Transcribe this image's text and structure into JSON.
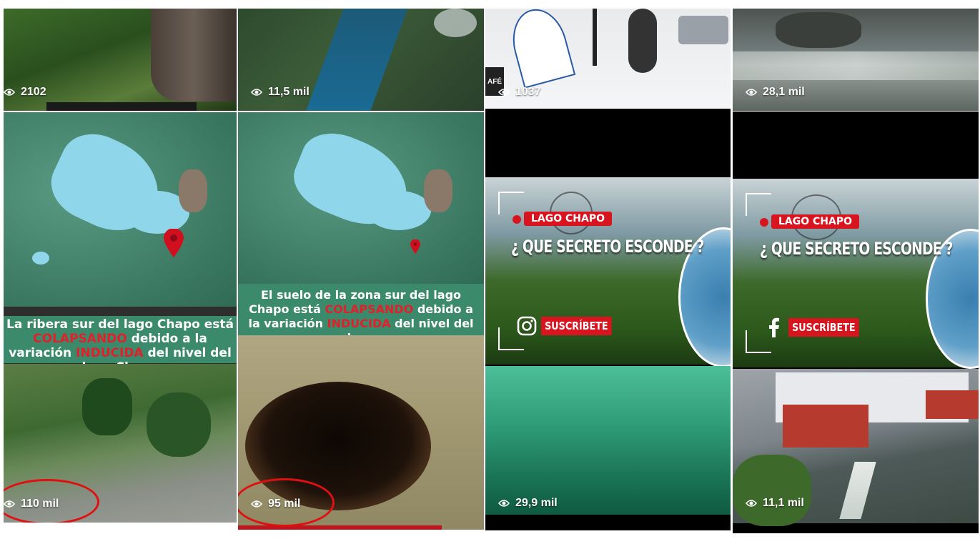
{
  "tiles": [
    {
      "views": "2102"
    },
    {
      "views": "11,5 mil"
    },
    {
      "views": "1037",
      "side_text": "AFÉ"
    },
    {
      "views": "28,1 mil"
    },
    {
      "views": "110 mil",
      "caption_parts": [
        "La ribera sur del lago Chapo está ",
        "COLAPSANDO",
        " debido a la variación ",
        "INDUCIDA",
        " del nivel del lago Chapo"
      ]
    },
    {
      "views": "95 mil",
      "caption_parts": [
        "El suelo de la zona sur del lago Chapo está ",
        "COLAPSANDO",
        " debido a la variación ",
        "INDUCIDA",
        " del nivel del lago"
      ]
    },
    {
      "views": "29,9 mil",
      "badge": "LAGO CHAPO",
      "headline": "¿ QUE SECRETO ESCONDE ?",
      "subscribe": "SUSCRÍBETE",
      "social": "instagram-icon"
    },
    {
      "views": "11,1 mil",
      "badge": "LAGO CHAPO",
      "headline": "¿ QUE SECRETO ESCONDE ?",
      "subscribe": "SUSCRÍBETE",
      "social": "facebook-icon"
    }
  ],
  "colors": {
    "caption_bg": "#3c8a6c",
    "accent_red": "#d8141f",
    "circle_red": "#e01010"
  }
}
